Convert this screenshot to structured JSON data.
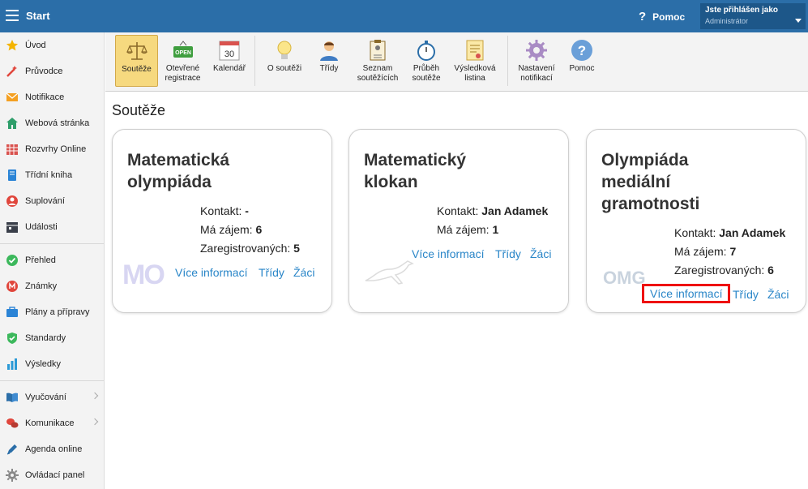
{
  "header": {
    "app_title": "Start",
    "help_label": "Pomoc",
    "user_label": "Jste přihlášen jako",
    "user_role": "Administrátor"
  },
  "sidebar": {
    "items": [
      {
        "label": "Úvod",
        "icon": "star-icon"
      },
      {
        "label": "Průvodce",
        "icon": "wand-icon"
      },
      {
        "label": "Notifikace",
        "icon": "envelope-icon"
      },
      {
        "label": "Webová stránka",
        "icon": "home-icon"
      },
      {
        "label": "Rozvrhy Online",
        "icon": "calendar-grid-icon"
      },
      {
        "label": "Třídní kniha",
        "icon": "book-icon"
      },
      {
        "label": "Suplování",
        "icon": "person-swap-icon"
      },
      {
        "label": "Události",
        "icon": "events-icon"
      },
      {
        "label": "Přehled",
        "icon": "check-circle-icon"
      },
      {
        "label": "Známky",
        "icon": "grade-icon"
      },
      {
        "label": "Plány a přípravy",
        "icon": "briefcase-icon"
      },
      {
        "label": "Standardy",
        "icon": "shield-check-icon"
      },
      {
        "label": "Výsledky",
        "icon": "bar-chart-icon"
      },
      {
        "label": "Vyučování",
        "icon": "open-book-icon"
      },
      {
        "label": "Komunikace",
        "icon": "chat-icon"
      },
      {
        "label": "Agenda online",
        "icon": "pen-icon"
      },
      {
        "label": "Ovládací panel",
        "icon": "gear-icon"
      }
    ]
  },
  "toolbar": {
    "souteze": "Soutěže",
    "otevrene_1": "Otevřené",
    "otevrene_2": "registrace",
    "open_badge": "OPEN",
    "kalendar": "Kalendář",
    "kalendar_day": "30",
    "o_soutezi": "O soutěži",
    "tridy": "Třídy",
    "seznam_1": "Seznam",
    "seznam_2": "soutěžících",
    "prubeh_1": "Průběh",
    "prubeh_2": "soutěže",
    "vysledkova_1": "Výsledková",
    "vysledkova_2": "listina",
    "nastaveni_1": "Nastavení",
    "nastaveni_2": "notifikací",
    "pomoc": "Pomoc"
  },
  "page": {
    "heading": "Soutěže"
  },
  "cards": [
    {
      "title_lines": [
        "Matematická",
        "olympiáda"
      ],
      "contact_label": "Kontakt:",
      "contact_value": "-",
      "interest_label": "Má zájem:",
      "interest_value": "6",
      "registered_label": "Zaregistrovaných:",
      "registered_value": "5",
      "logo_text": "MO",
      "link_info": "Více informací",
      "link_classes": "Třídy",
      "link_students": "Žáci"
    },
    {
      "title_lines": [
        "Matematický",
        "klokan"
      ],
      "contact_label": "Kontakt:",
      "contact_value": "Jan Adamek",
      "interest_label": "Má zájem:",
      "interest_value": "1",
      "link_info": "Více informací",
      "link_classes": "Třídy",
      "link_students": "Žáci"
    },
    {
      "title_lines": [
        "Olympiáda",
        "mediální",
        "gramotnosti"
      ],
      "contact_label": "Kontakt:",
      "contact_value": "Jan Adamek",
      "interest_label": "Má zájem:",
      "interest_value": "7",
      "registered_label": "Zaregistrovaných:",
      "registered_value": "6",
      "logo_text": "OMG",
      "link_info": "Více informací",
      "link_classes": "Třídy",
      "link_students": "Žáci"
    }
  ],
  "colors": {
    "header": "#2b6ea8",
    "link": "#2a86c8",
    "active_tool": "#f6d97f",
    "highlight": "#e11111"
  }
}
